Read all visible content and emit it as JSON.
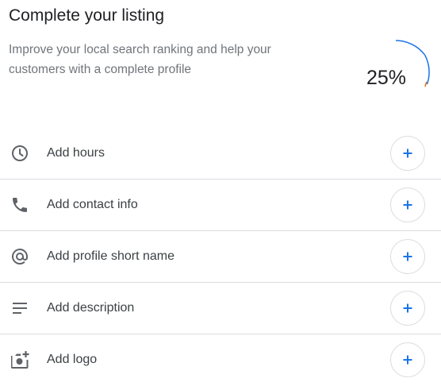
{
  "header": {
    "title": "Complete your listing",
    "subtitle": "Improve your local search ranking and help your customers with a complete profile"
  },
  "progress": {
    "value": 0.25,
    "label": "25%",
    "color": "#1a73e8",
    "accent_color": "#e37400"
  },
  "items": [
    {
      "label": "Add hours",
      "icon": "clock-icon"
    },
    {
      "label": "Add contact info",
      "icon": "phone-icon"
    },
    {
      "label": "Add profile short name",
      "icon": "at-sign-icon"
    },
    {
      "label": "Add description",
      "icon": "text-lines-icon"
    },
    {
      "label": "Add logo",
      "icon": "add-photo-icon"
    }
  ],
  "colors": {
    "icon": "#5f6368",
    "plus": "#1a73e8",
    "divider": "#dadce0"
  }
}
